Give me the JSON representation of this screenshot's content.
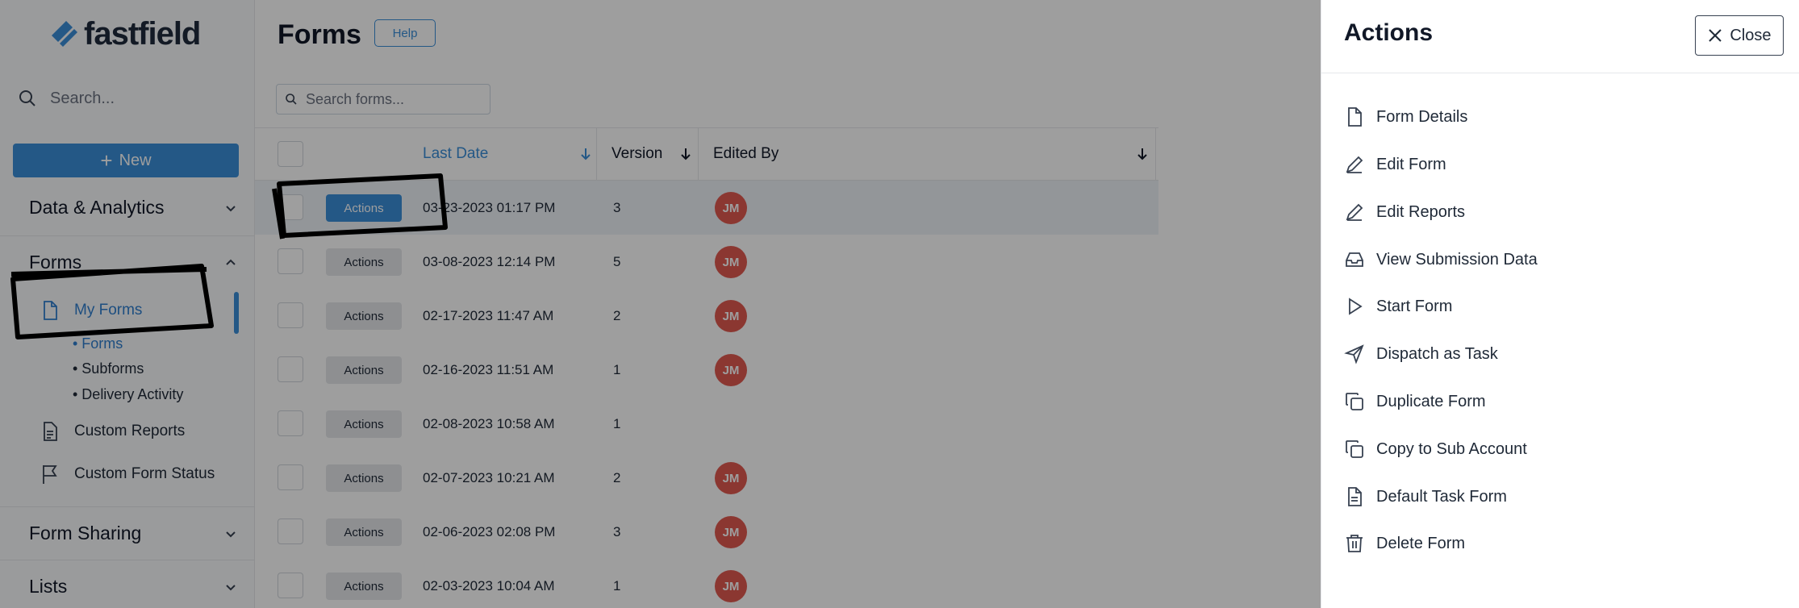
{
  "app": {
    "logo_text": "fastfield"
  },
  "sidebar": {
    "search_placeholder": "Search...",
    "new_label": "New",
    "sections": {
      "data_analytics": "Data & Analytics",
      "forms": "Forms",
      "form_sharing": "Form Sharing",
      "lists": "Lists"
    },
    "items": {
      "my_forms": "My Forms",
      "custom_reports": "Custom Reports",
      "custom_form_status": "Custom Form Status"
    },
    "subitems": {
      "forms": "• Forms",
      "subforms": "• Subforms",
      "delivery_activity": "• Delivery Activity"
    }
  },
  "main": {
    "title": "Forms",
    "help_label": "Help",
    "search_placeholder": "Search forms...",
    "columns": {
      "last_date": "Last Date",
      "version": "Version",
      "edited_by": "Edited By"
    },
    "actions_label": "Actions",
    "rows": [
      {
        "date": "03-23-2023 01:17 PM",
        "version": "3",
        "editor": "JM"
      },
      {
        "date": "03-08-2023 12:14 PM",
        "version": "5",
        "editor": "JM"
      },
      {
        "date": "02-17-2023 11:47 AM",
        "version": "2",
        "editor": "JM"
      },
      {
        "date": "02-16-2023 11:51 AM",
        "version": "1",
        "editor": "JM"
      },
      {
        "date": "02-08-2023 10:58 AM",
        "version": "1",
        "editor": ""
      },
      {
        "date": "02-07-2023 10:21 AM",
        "version": "2",
        "editor": "JM"
      },
      {
        "date": "02-06-2023 02:08 PM",
        "version": "3",
        "editor": "JM"
      },
      {
        "date": "02-03-2023 10:04 AM",
        "version": "1",
        "editor": "JM"
      }
    ]
  },
  "panel": {
    "title": "Actions",
    "close_label": "Close",
    "items": {
      "form_details": "Form Details",
      "edit_form": "Edit Form",
      "edit_reports": "Edit Reports",
      "view_submission_data": "View Submission Data",
      "start_form": "Start Form",
      "dispatch_as_task": "Dispatch as Task",
      "duplicate_form": "Duplicate Form",
      "copy_to_sub_account": "Copy to Sub Account",
      "default_task_form": "Default Task Form",
      "delete_form": "Delete Form"
    }
  },
  "colors": {
    "accent": "#3b8ed8",
    "avatar": "#e05a4f"
  }
}
